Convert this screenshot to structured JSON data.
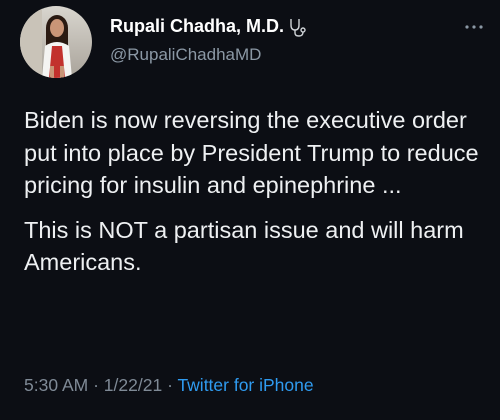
{
  "tweet": {
    "author": {
      "display_name": "Rupali Chadha, M.D.",
      "handle": "@RupaliChadhaMD",
      "badge_icon": "stethoscope-icon",
      "avatar_icon": "profile-photo"
    },
    "menu_icon": "more-options-icon",
    "paragraphs": [
      "Biden is now reversing the executive order put into place by President Trump to reduce pricing for insulin and epinephrine ...",
      "This is NOT a partisan issue and will harm Americans."
    ],
    "time": "5:30 AM",
    "date": "1/22/21",
    "separator": "·",
    "source": "Twitter for iPhone"
  },
  "colors": {
    "background": "#0c0e14",
    "text": "#eef0f2",
    "muted": "#7f8a96",
    "link": "#2f9bf0"
  }
}
